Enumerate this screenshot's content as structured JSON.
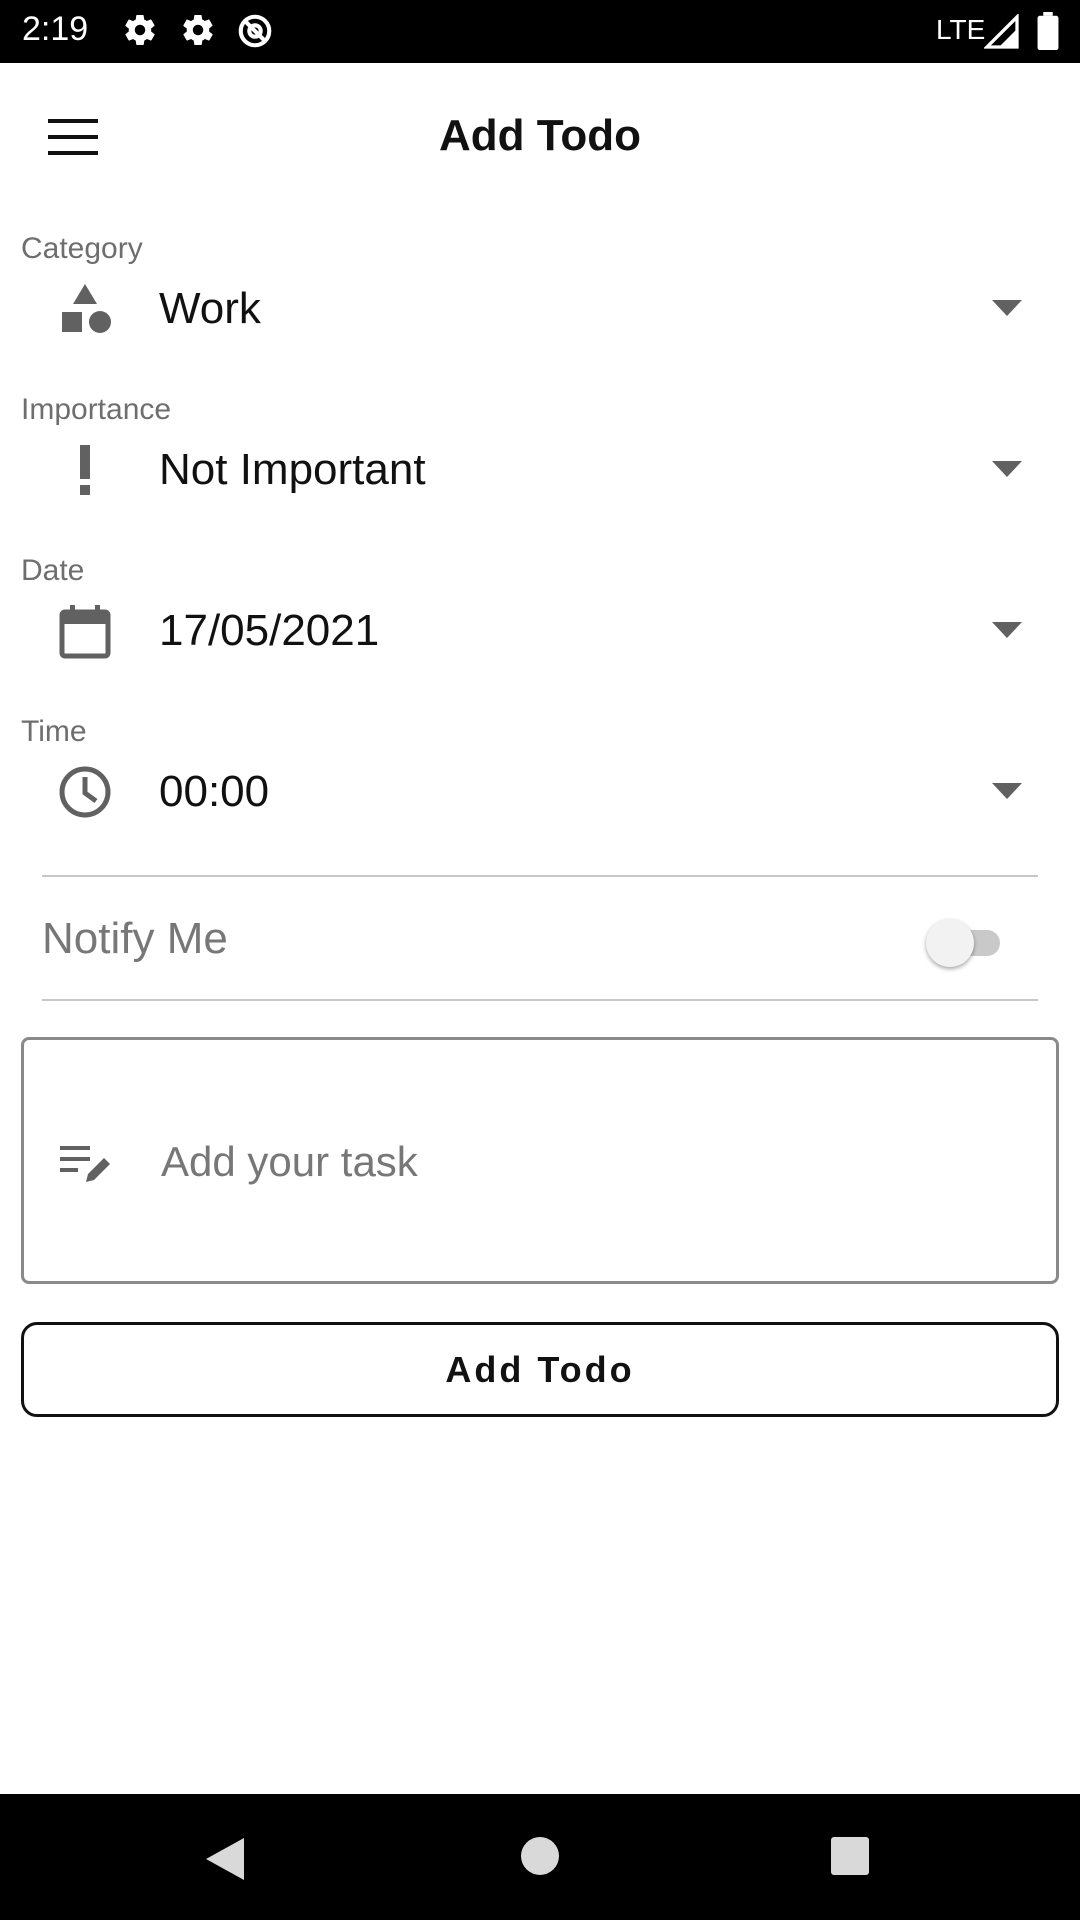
{
  "status_bar": {
    "time": "2:19",
    "network": "LTE",
    "icons": [
      "settings-icon",
      "settings-icon",
      "at-sign-icon",
      "signal-icon",
      "battery-icon"
    ]
  },
  "app_bar": {
    "title": "Add Todo",
    "menu_icon": "hamburger-menu-icon"
  },
  "form": {
    "category": {
      "label": "Category",
      "value": "Work",
      "icon": "category-shapes-icon"
    },
    "importance": {
      "label": "Importance",
      "value": "Not Important",
      "icon": "exclamation-icon"
    },
    "date": {
      "label": "Date",
      "value": "17/05/2021",
      "icon": "calendar-icon"
    },
    "time": {
      "label": "Time",
      "value": "00:00",
      "icon": "clock-icon"
    },
    "notify": {
      "label": "Notify Me",
      "enabled": false
    },
    "task": {
      "placeholder": "Add your task",
      "value": "",
      "icon": "edit-note-icon"
    }
  },
  "actions": {
    "add_label": "Add Todo"
  },
  "colors": {
    "text_primary": "#111111",
    "text_secondary": "#6e6e6e",
    "icon_gray": "#616161",
    "divider": "#c8c8c8",
    "bar_background": "#000000"
  },
  "nav_bar": {
    "icons": [
      "back-triangle-icon",
      "home-circle-icon",
      "recents-square-icon"
    ]
  }
}
